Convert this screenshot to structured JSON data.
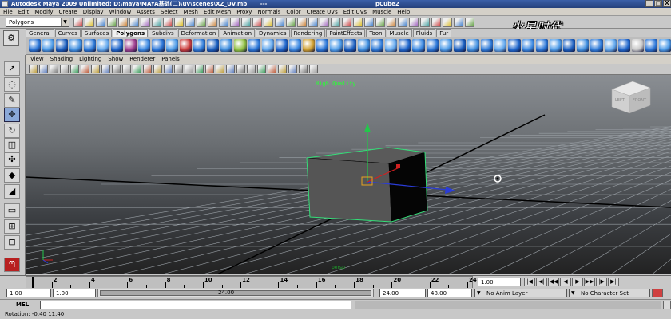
{
  "window": {
    "title": "Autodesk Maya 2009 Unlimited: D:\\maya\\MAYA基础(二)\\uv\\scenes\\XZ_UV.mb",
    "separator": "---",
    "selected_node": "pCube2",
    "controls": [
      "_",
      "□",
      "X"
    ]
  },
  "menubar": [
    "File",
    "Edit",
    "Modify",
    "Create",
    "Display",
    "Window",
    "Assets",
    "Select",
    "Mesh",
    "Edit Mesh",
    "Proxy",
    "Normals",
    "Color",
    "Create UVs",
    "Edit UVs",
    "Muscle",
    "Help"
  ],
  "statusline": {
    "mode": "Polygons"
  },
  "shelf": {
    "tabs": [
      "General",
      "Curves",
      "Surfaces",
      "Polygons",
      "Subdivs",
      "Deformation",
      "Animation",
      "Dynamics",
      "Rendering",
      "PaintEffects",
      "Toon",
      "Muscle",
      "Fluids",
      "Fur"
    ],
    "active_tab": "Polygons",
    "icon_colors": [
      "#2a76d8",
      "#4c9be8",
      "#1a5fc0",
      "#3f8fe0",
      "#2d7ad8",
      "#62a8ee",
      "#1f66cc",
      "#a04090",
      "#3a88e2",
      "#2a76d8",
      "#4c9be8",
      "#cc3c3c",
      "#2d7ad8",
      "#1a5fc0",
      "#3f8fe0",
      "#8fbf40",
      "#2a76d8",
      "#62a8ee",
      "#1f66cc",
      "#3a88e2",
      "#d0a030",
      "#2a76d8",
      "#4c9be8",
      "#1a5fc0",
      "#3f8fe0",
      "#2d7ad8",
      "#62a8ee",
      "#1f66cc",
      "#3a88e2",
      "#2a76d8",
      "#4c9be8",
      "#1a5fc0",
      "#3f8fe0",
      "#2d7ad8",
      "#62a8ee",
      "#1f66cc",
      "#3a88e2",
      "#2a76d8",
      "#4c9be8",
      "#1a5fc0",
      "#3f8fe0",
      "#2d7ad8",
      "#62a8ee",
      "#1f66cc",
      "#c8c8c8",
      "#2a76d8",
      "#4c9be8"
    ]
  },
  "watermark": "火星时代",
  "panel_menu": [
    "View",
    "Shading",
    "Lighting",
    "Show",
    "Renderer",
    "Panels"
  ],
  "viewport": {
    "hud_text": "High Quality",
    "camera_label": "persp",
    "viewcube_label": "LEFT",
    "viewcube_label2": "FRONT",
    "colors": {
      "hud": "#3fe24a",
      "selection": "#36e07a",
      "axis_y": "#22c84a",
      "axis_x": "#d02020",
      "axis_z": "#2a3cd8",
      "pivot": "#e6a420"
    }
  },
  "timeslider": {
    "ticks": [
      "2",
      "4",
      "6",
      "8",
      "10",
      "12",
      "14",
      "16",
      "18",
      "20",
      "22",
      "24"
    ],
    "current_frame": "1.00",
    "play_controls": [
      "|◀",
      "◀|",
      "◀◀",
      "◀",
      "▶",
      "▶▶",
      "|▶",
      "▶|"
    ]
  },
  "range": {
    "start": "1.00",
    "playback_start": "1.00",
    "slider_value": "24.00",
    "playback_end": "24.00",
    "end": "48.00",
    "anim_layer": "No Anim Layer",
    "character_set": "No Character Set"
  },
  "cmdline": {
    "label": "MEL"
  },
  "helpline": {
    "text": "Rotation:  -0.40      11.40"
  }
}
